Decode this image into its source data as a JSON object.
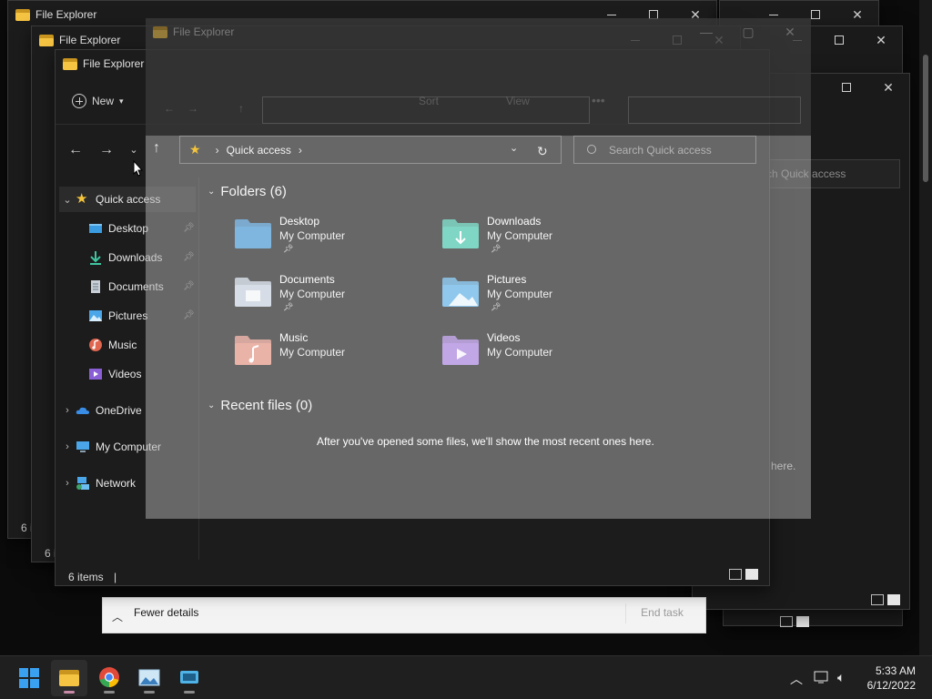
{
  "app_title": "File Explorer",
  "toolbar": {
    "new_label": "New",
    "sort_label": "Sort",
    "view_label": "View"
  },
  "address": {
    "location": "Quick access"
  },
  "search": {
    "placeholder": "Search Quick access",
    "bg_placeholder": "ch Quick access"
  },
  "sidebar": {
    "quick_access": "Quick access",
    "pinned": [
      {
        "label": "Desktop"
      },
      {
        "label": "Downloads"
      },
      {
        "label": "Documents"
      },
      {
        "label": "Pictures"
      },
      {
        "label": "Music"
      },
      {
        "label": "Videos"
      }
    ],
    "roots": [
      {
        "label": "OneDrive"
      },
      {
        "label": "My Computer"
      },
      {
        "label": "Network"
      }
    ]
  },
  "folders_header": "Folders (6)",
  "folders": [
    {
      "name": "Desktop",
      "location": "My Computer",
      "pinned": true,
      "color": "#7fb6e0"
    },
    {
      "name": "Downloads",
      "location": "My Computer",
      "pinned": true,
      "color": "#7fd6c4"
    },
    {
      "name": "Documents",
      "location": "My Computer",
      "pinned": true,
      "color": "#d6dde6"
    },
    {
      "name": "Pictures",
      "location": "My Computer",
      "pinned": true,
      "color": "#8fc8ec"
    },
    {
      "name": "Music",
      "location": "My Computer",
      "pinned": false,
      "color": "#eab3a8"
    },
    {
      "name": "Videos",
      "location": "My Computer",
      "pinned": false,
      "color": "#c1a7e6"
    }
  ],
  "recent_header": "Recent files (0)",
  "recent_empty_message": "After you've opened some files, we'll show the most recent ones here.",
  "recent_empty_tail": "here.",
  "status": {
    "items_count": "6 items",
    "bg_count": "6 i"
  },
  "task_manager": {
    "fewer_details": "Fewer details",
    "end_task": "End task"
  },
  "taskbar": {
    "apps": [
      "start-icon",
      "file-explorer-icon",
      "chrome-icon",
      "photos-icon",
      "remote-desktop-icon"
    ],
    "time": "5:33 AM",
    "date": "6/12/2022"
  }
}
